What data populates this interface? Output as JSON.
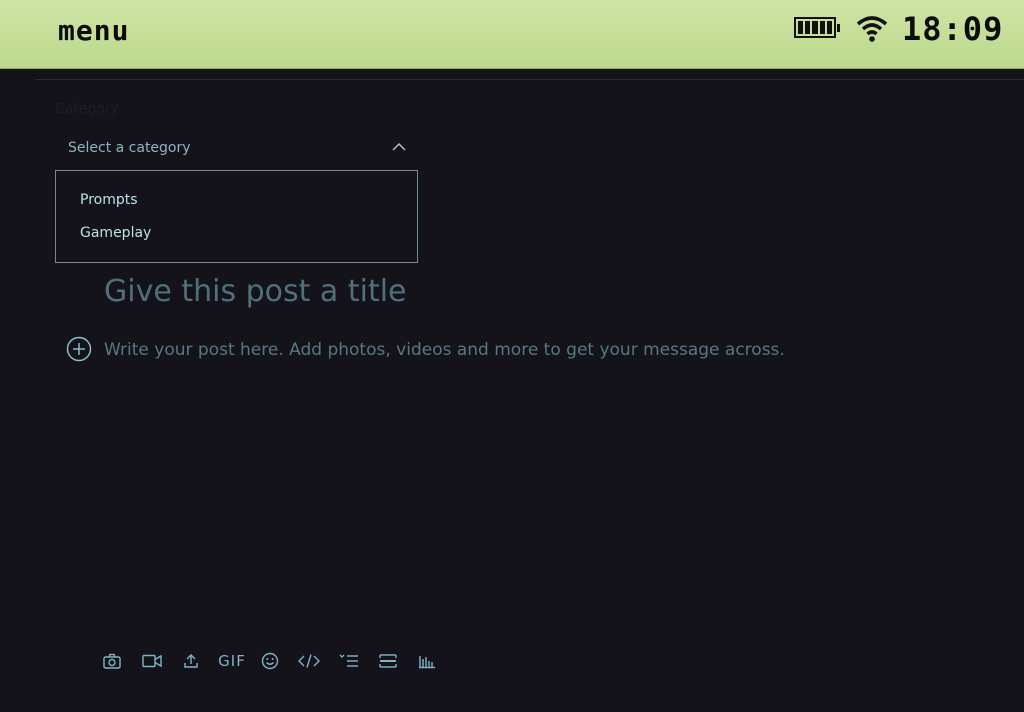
{
  "statusbar": {
    "title": "menu",
    "time": "18:09",
    "battery_icon": "battery-icon",
    "wifi_icon": "wifi-icon"
  },
  "editor": {
    "category_label": "Category",
    "category_placeholder": "Select a category",
    "category_options": [
      "Prompts",
      "Gameplay"
    ],
    "title_placeholder": "Give this post a title",
    "body_placeholder": "Write your post here. Add photos, videos and more to get your message across."
  },
  "toolbar": {
    "items": [
      {
        "icon": "camera-icon"
      },
      {
        "icon": "video-icon"
      },
      {
        "icon": "upload-icon"
      },
      {
        "icon": "gif-icon",
        "label": "GIF"
      },
      {
        "icon": "emoji-icon"
      },
      {
        "icon": "code-icon"
      },
      {
        "icon": "list-icon"
      },
      {
        "icon": "divider-icon"
      },
      {
        "icon": "poll-icon"
      }
    ]
  },
  "colors": {
    "background": "#15131a",
    "statusbar": "#c4dd96",
    "accent": "#7fb4c7",
    "text_muted": "#567883"
  }
}
